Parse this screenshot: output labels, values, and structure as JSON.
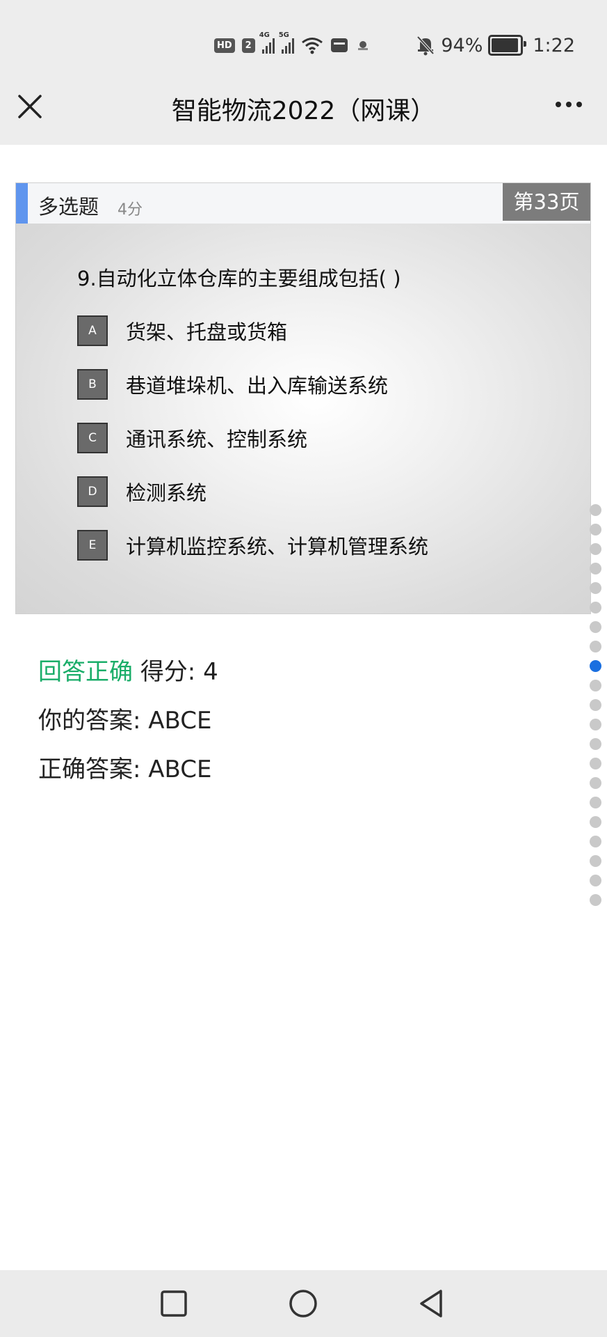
{
  "status_bar": {
    "hd_badge": "HD",
    "sim_badge": "2",
    "net1": "4G",
    "net2": "5G",
    "battery": "94%",
    "battery_level": 0.94,
    "time": "1:22"
  },
  "nav": {
    "title": "智能物流2022（网课）"
  },
  "question": {
    "type": "多选题",
    "points": "4分",
    "page_badge": "第33页",
    "text": "9.自动化立体仓库的主要组成包括(      )",
    "options": [
      {
        "letter": "A",
        "text": "货架、托盘或货箱"
      },
      {
        "letter": "B",
        "text": "巷道堆垛机、出入库输送系统"
      },
      {
        "letter": "C",
        "text": "通讯系统、控制系统"
      },
      {
        "letter": "D",
        "text": "检测系统"
      },
      {
        "letter": "E",
        "text": "计算机监控系统、计算机管理系统"
      }
    ]
  },
  "result": {
    "status": "回答正确",
    "score": "得分: 4",
    "your_answer": "你的答案: ABCE",
    "correct_answer": "正确答案: ABCE",
    "status_color": "#1aad69"
  },
  "page_indicator": {
    "total": 21,
    "active_index": 8,
    "active_color": "#1a6fe0"
  },
  "colors": {
    "accent": "#5f95ee",
    "page_badge_bg": "#7c7c7c"
  }
}
